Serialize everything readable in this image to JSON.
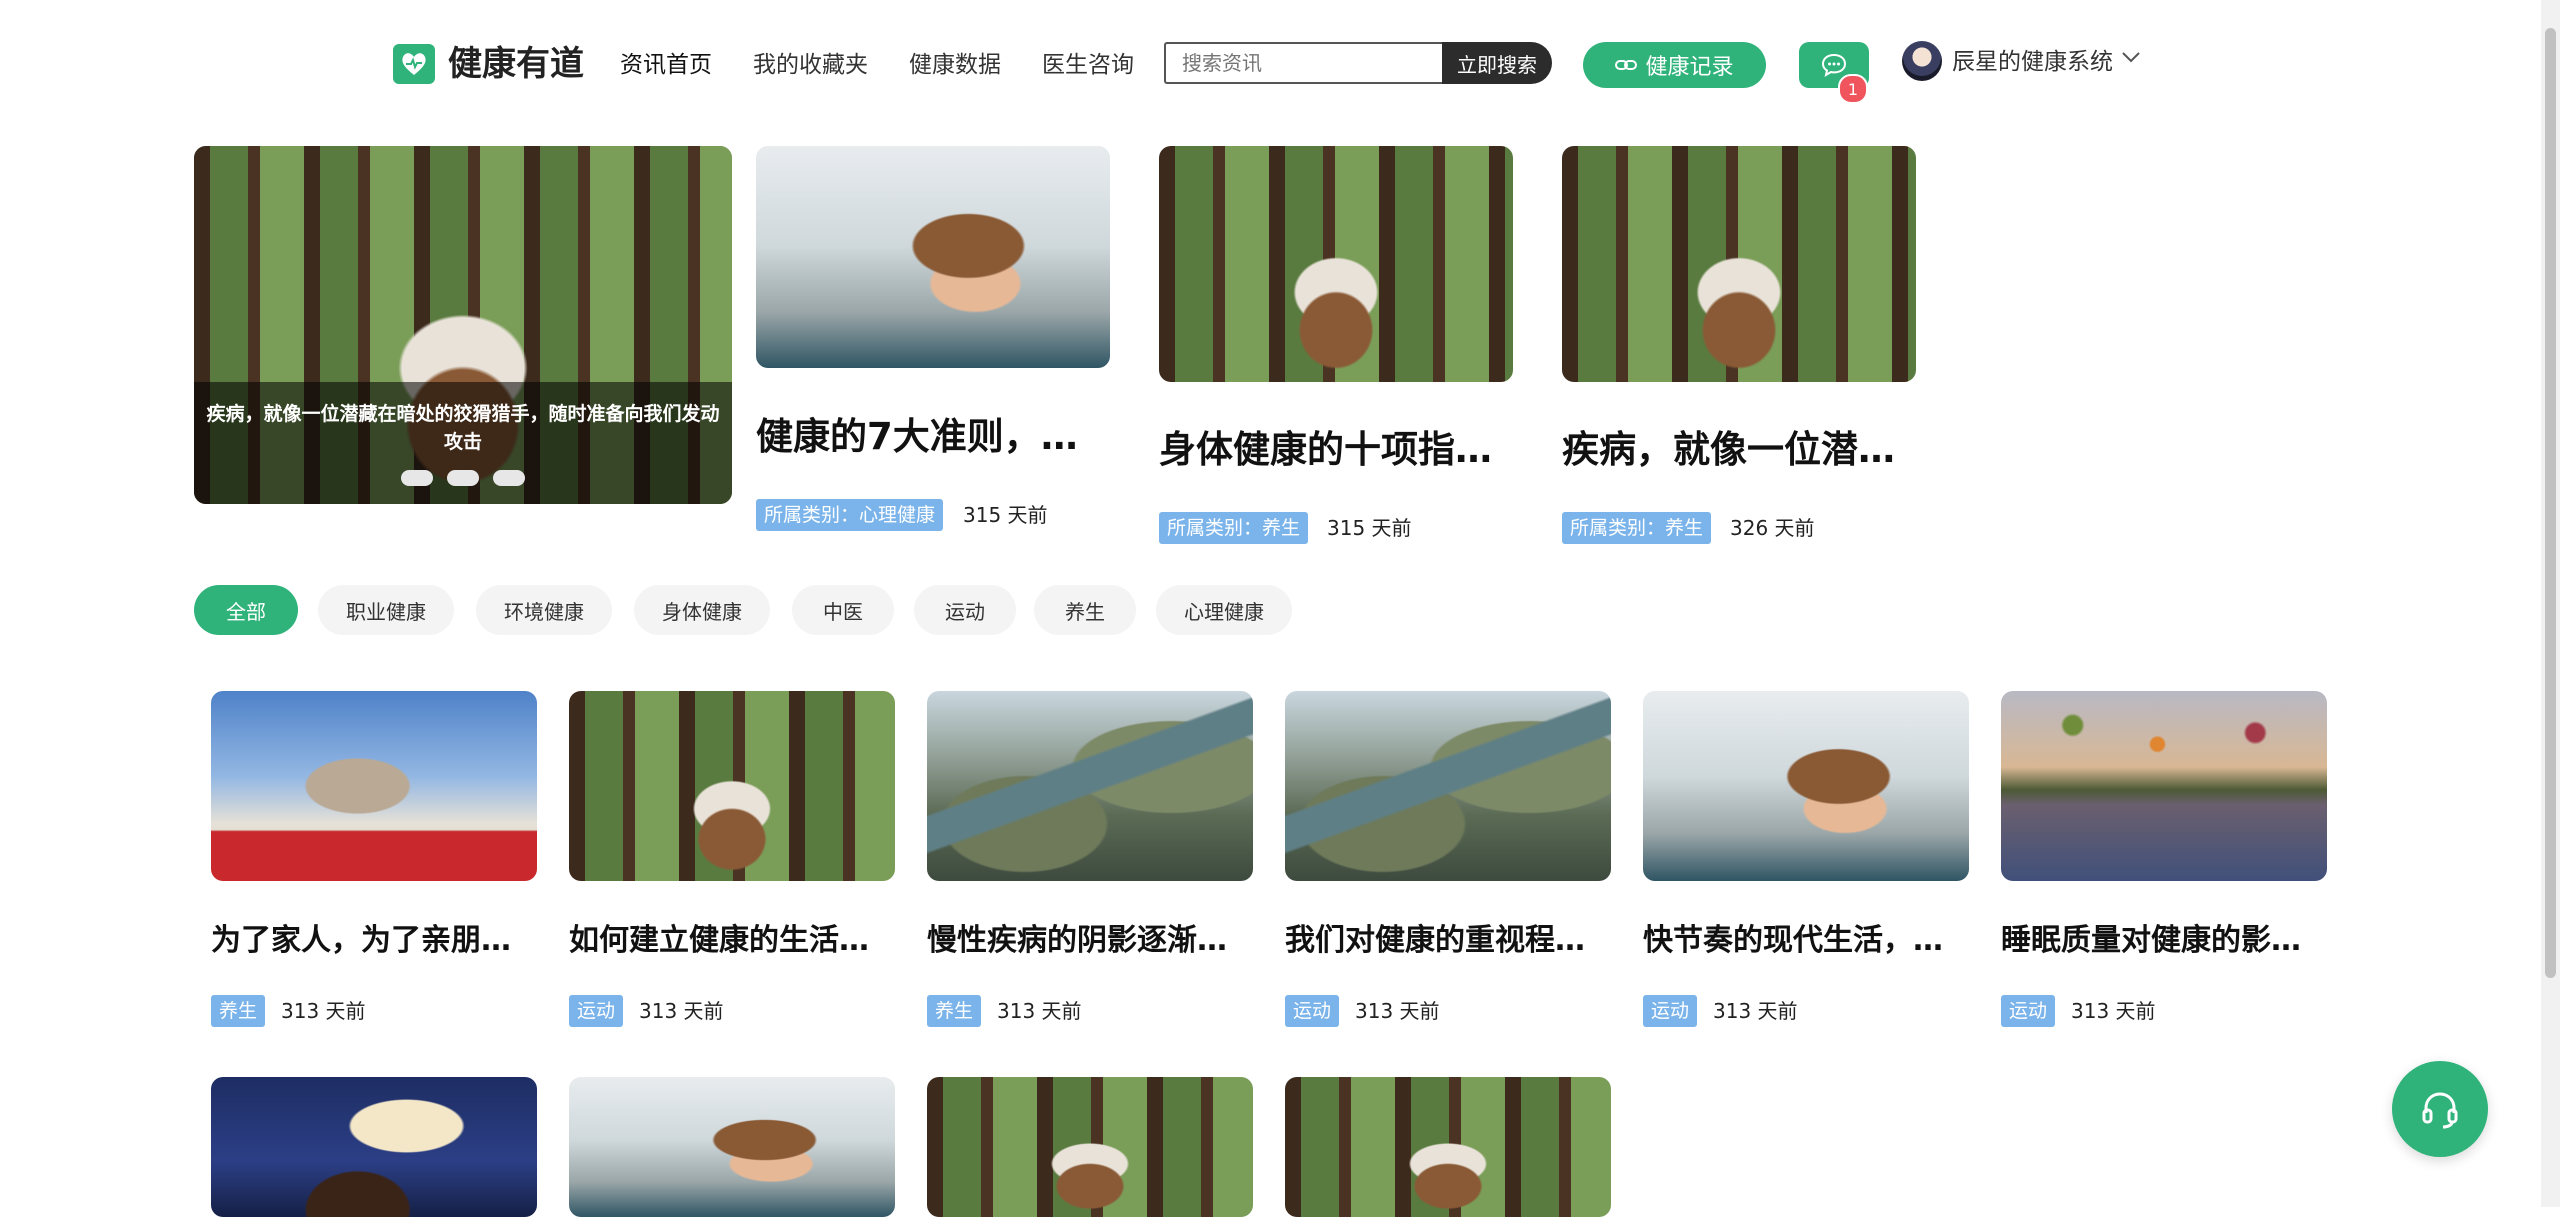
{
  "header": {
    "logo_text": "健康有道",
    "nav": [
      "资讯首页",
      "我的收藏夹",
      "健康数据",
      "医生咨询"
    ],
    "search": {
      "placeholder": "搜索资讯",
      "button": "立即搜索"
    },
    "record_button": "健康记录",
    "message_count": "1",
    "user_name": "辰星的健康系统"
  },
  "carousel": {
    "caption": "疾病，就像一位潜藏在暗处的狡猾猎手，随时准备向我们发动攻击",
    "dots": 3
  },
  "featured": [
    {
      "title": "健康的7大准则，…",
      "category": "所属类别：心理健康",
      "time": "315 天前"
    },
    {
      "title": "身体健康的十项指…",
      "category": "所属类别：养生",
      "time": "315 天前"
    },
    {
      "title": "疾病，就像一位潜…",
      "category": "所属类别：养生",
      "time": "326 天前"
    }
  ],
  "categories": [
    "全部",
    "职业健康",
    "环境健康",
    "身体健康",
    "中医",
    "运动",
    "养生",
    "心理健康"
  ],
  "articles": [
    {
      "title": "为了家人，为了亲朋…",
      "category": "养生",
      "time": "313 天前"
    },
    {
      "title": "如何建立健康的生活…",
      "category": "运动",
      "time": "313 天前"
    },
    {
      "title": "慢性疾病的阴影逐渐…",
      "category": "养生",
      "time": "313 天前"
    },
    {
      "title": "我们对健康的重视程…",
      "category": "运动",
      "time": "313 天前"
    },
    {
      "title": "快节奏的现代生活，…",
      "category": "运动",
      "time": "313 天前"
    },
    {
      "title": "睡眠质量对健康的影…",
      "category": "运动",
      "time": "313 天前"
    }
  ],
  "colors": {
    "brand": "#2fb37a",
    "badge": "#7bb4ea",
    "notification": "#f0545c"
  },
  "icons": {
    "logo": "heart-icon",
    "record": "link-icon",
    "message": "chat-icon",
    "user_menu": "chevron-down-icon",
    "support": "headset-icon"
  }
}
